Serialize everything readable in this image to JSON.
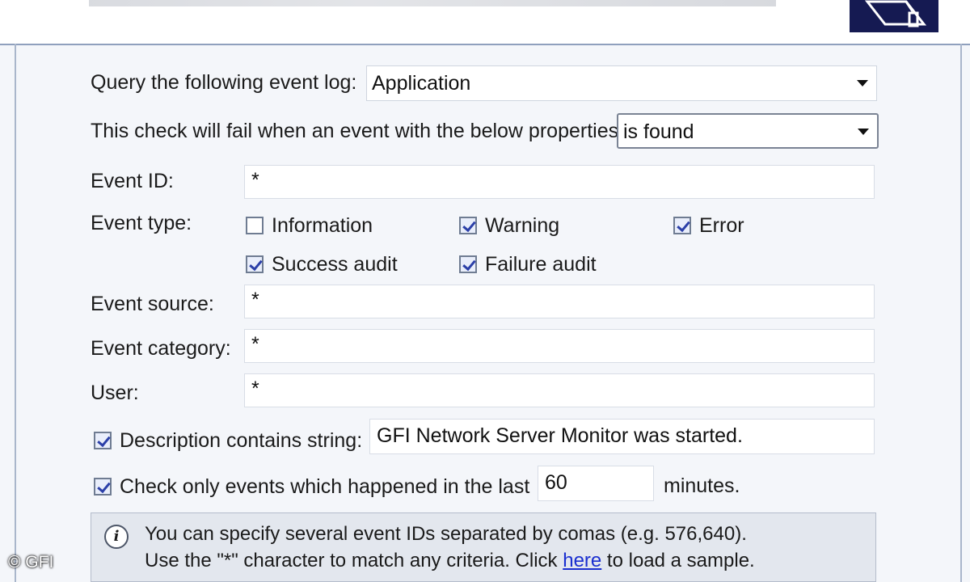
{
  "query": {
    "label": "Query the following event log:",
    "selected": "Application"
  },
  "fail_condition": {
    "label": "This check will fail when an event with the below properties",
    "selected": "is found"
  },
  "event_id": {
    "label": "Event ID:",
    "value": "*"
  },
  "event_type": {
    "label": "Event type:",
    "options": [
      {
        "label": "Information",
        "checked": false
      },
      {
        "label": "Warning",
        "checked": true
      },
      {
        "label": "Error",
        "checked": true
      },
      {
        "label": "Success audit",
        "checked": true
      },
      {
        "label": "Failure audit",
        "checked": true
      }
    ]
  },
  "event_source": {
    "label": "Event source:",
    "value": "*"
  },
  "event_category": {
    "label": "Event category:",
    "value": "*"
  },
  "user": {
    "label": "User:",
    "value": "*"
  },
  "description": {
    "checked": true,
    "label": "Description contains string:",
    "value": "GFI Network Server Monitor was started."
  },
  "time_window": {
    "checked": true,
    "label": "Check only events which happened in the last",
    "value": "60",
    "unit": "minutes."
  },
  "info": {
    "icon": "info-icon",
    "line1": "You can specify several event IDs separated by comas (e.g. 576,640).",
    "line2_before": "Use the \"*\" character to match any criteria.  Click ",
    "link": "here",
    "line2_after": " to load a sample."
  },
  "watermark": "© GFI"
}
